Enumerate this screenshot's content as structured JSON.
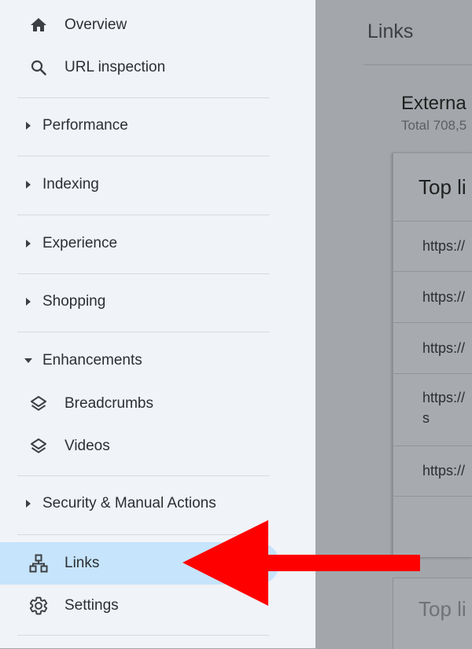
{
  "sidebar": {
    "overview": "Overview",
    "url_inspection": "URL inspection",
    "performance": "Performance",
    "indexing": "Indexing",
    "experience": "Experience",
    "shopping": "Shopping",
    "enhancements": "Enhancements",
    "breadcrumbs": "Breadcrumbs",
    "videos": "Videos",
    "security": "Security & Manual Actions",
    "links": "Links",
    "settings": "Settings",
    "active_item": "Links"
  },
  "main": {
    "page_title": "Links",
    "external_title": "Externa",
    "external_total": "Total 708,5",
    "card_title": "Top li",
    "rows": [
      "https://",
      "https://",
      "https://",
      "https://",
      "https://"
    ],
    "row4_wrap": "s",
    "card2_title": "Top li"
  },
  "colors": {
    "sidebar_bg": "#f0f3f8",
    "active_bg": "#c6e4fb",
    "overlay": "#a3a7ab",
    "arrow": "#ff0000"
  }
}
